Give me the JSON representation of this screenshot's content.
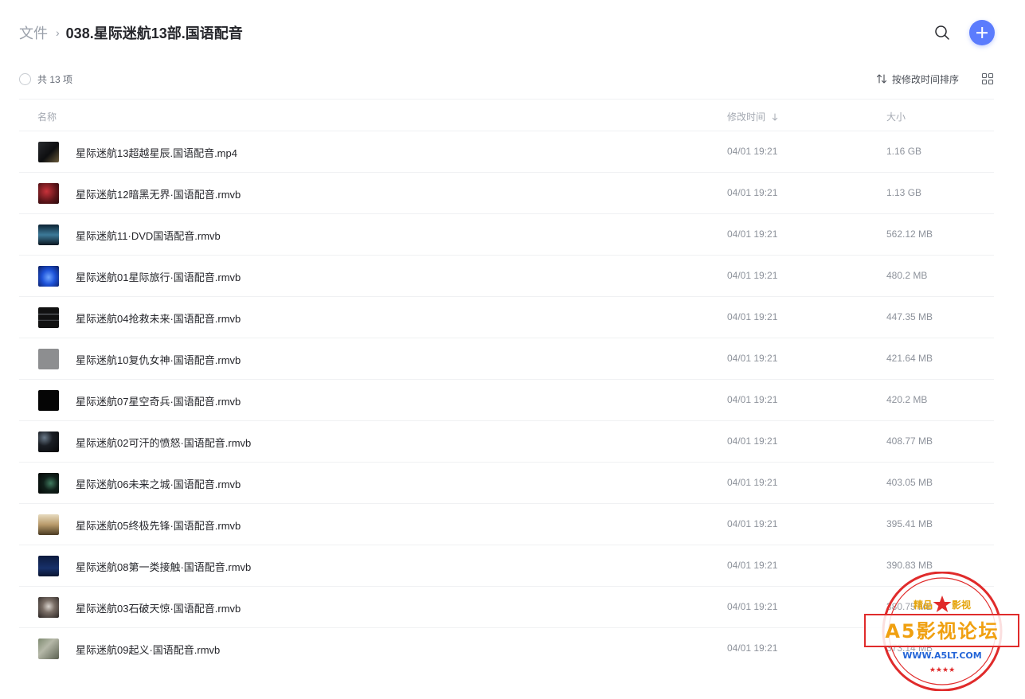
{
  "breadcrumb": {
    "root": "文件",
    "separator": "›",
    "current": "038.星际迷航13部.国语配音"
  },
  "header": {
    "search_icon": "search-icon",
    "add_icon": "plus-icon",
    "accent_color": "#5b7cfd"
  },
  "toolbar": {
    "count_text": "共 13 项",
    "sort_label": "按修改时间排序"
  },
  "columns": {
    "name": "名称",
    "modified": "修改时间",
    "size": "大小"
  },
  "files": [
    {
      "name": "星际迷航13超越星辰.国语配音.mp4",
      "modified": "04/01 19:21",
      "size": "1.16 GB"
    },
    {
      "name": "星际迷航12暗黑无界·国语配音.rmvb",
      "modified": "04/01 19:21",
      "size": "1.13 GB"
    },
    {
      "name": "星际迷航11·DVD国语配音.rmvb",
      "modified": "04/01 19:21",
      "size": "562.12 MB"
    },
    {
      "name": "星际迷航01星际旅行·国语配音.rmvb",
      "modified": "04/01 19:21",
      "size": "480.2 MB"
    },
    {
      "name": "星际迷航04抢救未来·国语配音.rmvb",
      "modified": "04/01 19:21",
      "size": "447.35 MB"
    },
    {
      "name": "星际迷航10复仇女神·国语配音.rmvb",
      "modified": "04/01 19:21",
      "size": "421.64 MB"
    },
    {
      "name": "星际迷航07星空奇兵·国语配音.rmvb",
      "modified": "04/01 19:21",
      "size": "420.2 MB"
    },
    {
      "name": "星际迷航02可汗的愤怒·国语配音.rmvb",
      "modified": "04/01 19:21",
      "size": "408.77 MB"
    },
    {
      "name": "星际迷航06未来之城·国语配音.rmvb",
      "modified": "04/01 19:21",
      "size": "403.05 MB"
    },
    {
      "name": "星际迷航05终极先锋·国语配音.rmvb",
      "modified": "04/01 19:21",
      "size": "395.41 MB"
    },
    {
      "name": "星际迷航08第一类接触·国语配音.rmvb",
      "modified": "04/01 19:21",
      "size": "390.83 MB"
    },
    {
      "name": "星际迷航03石破天惊·国语配音.rmvb",
      "modified": "04/01 19:21",
      "size": "380.75 MB"
    },
    {
      "name": "星际迷航09起义·国语配音.rmvb",
      "modified": "04/01 19:21",
      "size": "373.14 MB"
    }
  ],
  "watermark": {
    "top_left": "精品",
    "top_right": "影视",
    "main": "A5影视论坛",
    "url": "WWW.A5LT.COM",
    "color": "#e02b2b"
  }
}
